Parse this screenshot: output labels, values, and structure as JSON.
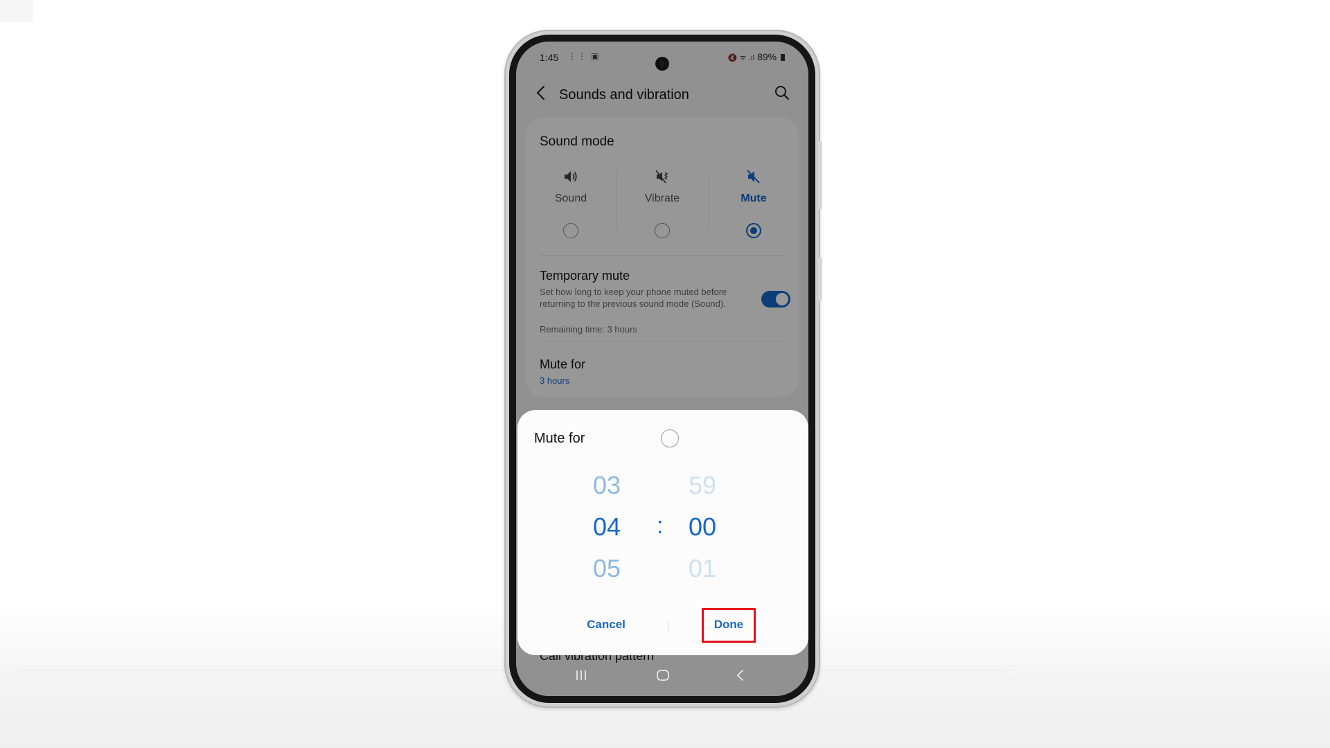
{
  "status_bar": {
    "time": "1:45",
    "left_icons": "⋮⋮ ▣",
    "right_icons": "🔇 ᯤ .ıl",
    "battery": "89%"
  },
  "appbar": {
    "title": "Sounds and vibration"
  },
  "sound_mode": {
    "title": "Sound mode",
    "options": [
      {
        "label": "Sound",
        "icon": "volume-icon",
        "selected": false
      },
      {
        "label": "Vibrate",
        "icon": "vibrate-icon",
        "selected": false
      },
      {
        "label": "Mute",
        "icon": "mute-icon",
        "selected": true
      }
    ]
  },
  "temporary_mute": {
    "title": "Temporary mute",
    "description": "Set how long to keep your phone muted before returning to the previous sound mode (Sound).",
    "enabled": true,
    "remaining": "Remaining time: 3 hours"
  },
  "mute_for_row": {
    "title": "Mute for",
    "value": "3 hours"
  },
  "partial_row": "Call vibration pattern",
  "dialog": {
    "title": "Mute for",
    "hours": {
      "prev": "03",
      "current": "04",
      "next": "05"
    },
    "separator": ":",
    "minutes": {
      "prev": "59",
      "current": "00",
      "next": "01"
    },
    "cancel_label": "Cancel",
    "done_label": "Done"
  },
  "colors": {
    "accent": "#1767c7",
    "highlight": "#e3101a"
  }
}
